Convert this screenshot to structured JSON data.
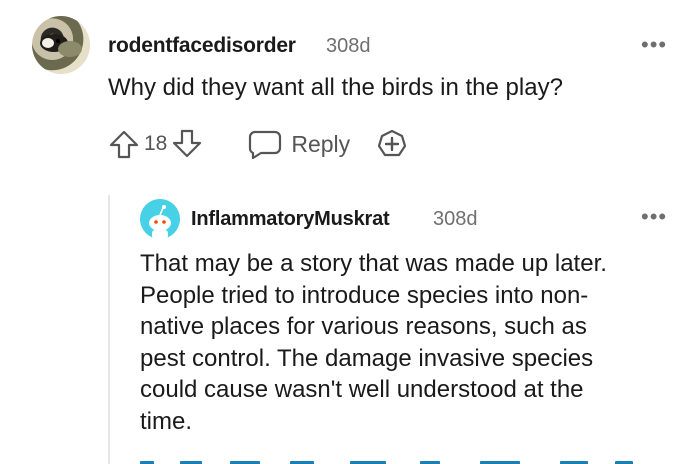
{
  "comment": {
    "username": "rodentfacedisorder",
    "timestamp": "308d",
    "more": "•••",
    "text": "Why did they want all the birds in the play?",
    "upvotes": "18",
    "reply_label": "Reply"
  },
  "reply": {
    "username": "InflammatoryMuskrat",
    "timestamp": "308d",
    "more": "•••",
    "lines": [
      "That may be a story that was made up later.",
      "People tried to introduce species into non-",
      "native places for various reasons, such as",
      "pest control. The damage invasive species",
      "could cause wasn't well understood at the",
      "time."
    ]
  },
  "colors": {
    "accent_link": "#1a7fb5",
    "avatar_bg": "#46d1e6",
    "muted": "#6f6f6f"
  },
  "icons": [
    "upvote-icon",
    "downvote-icon",
    "comment-bubble-icon",
    "award-plus-icon",
    "more-options-icon",
    "snoo-avatar-icon"
  ]
}
